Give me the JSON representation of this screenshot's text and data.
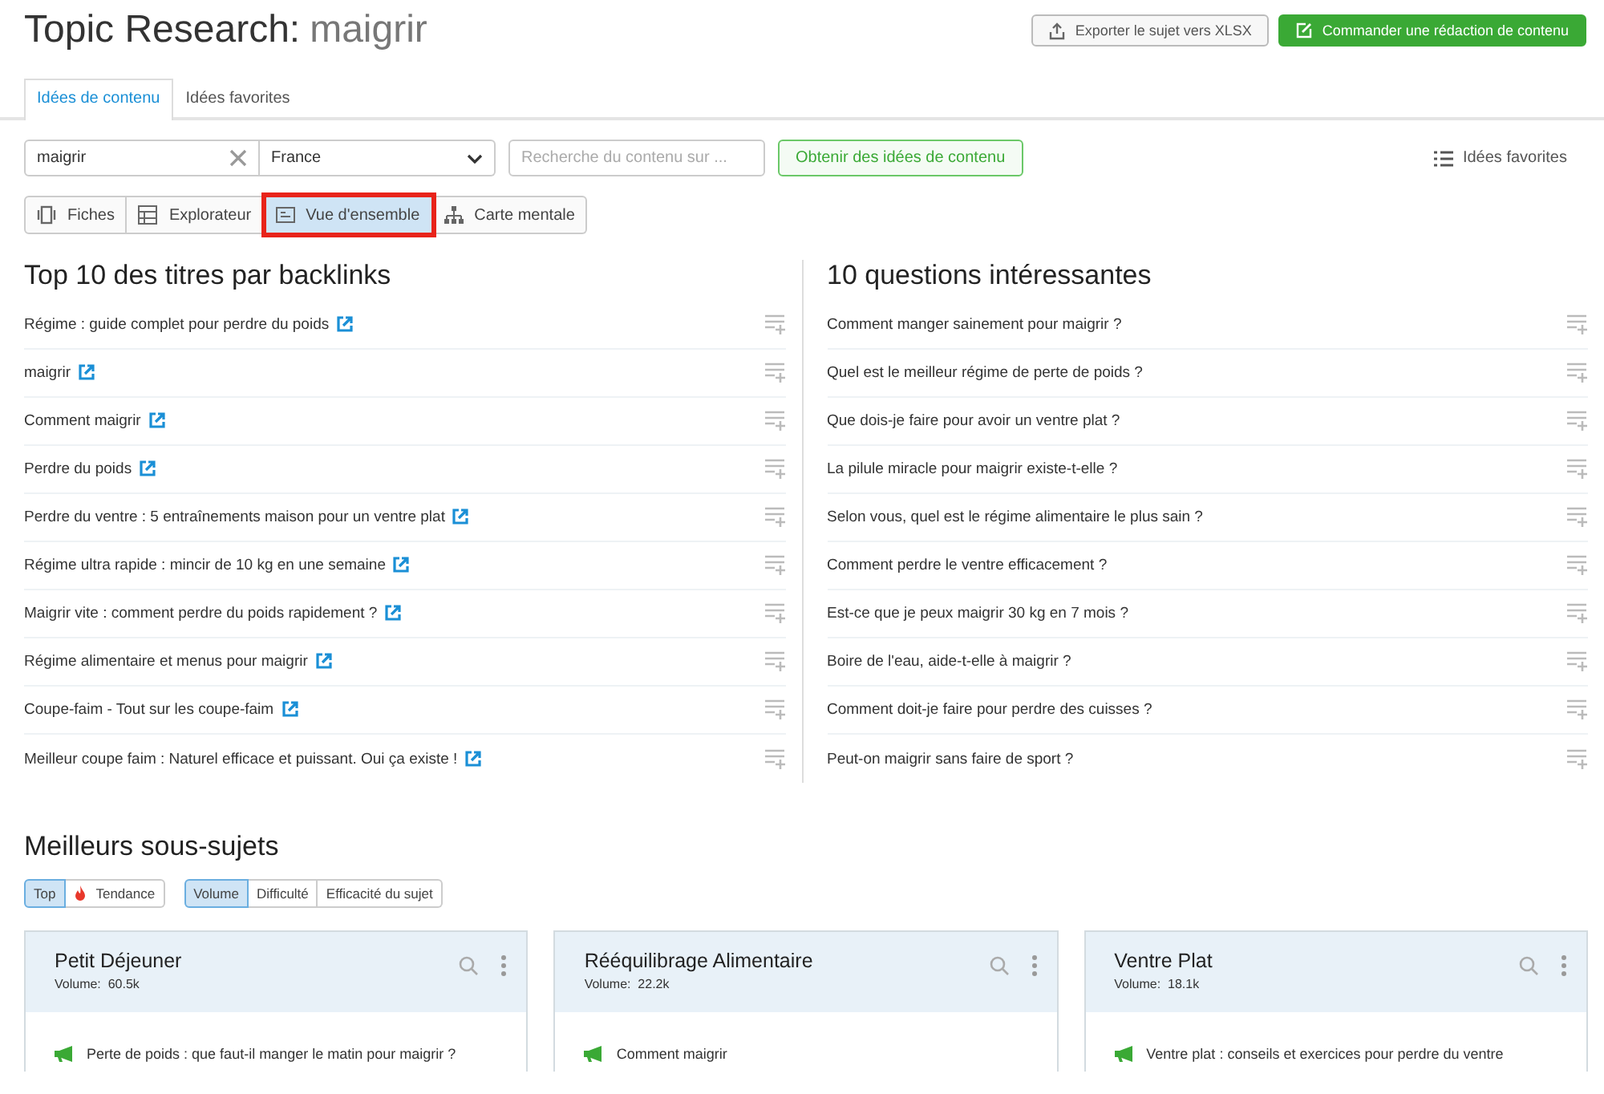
{
  "header": {
    "title": "Topic Research:",
    "keyword": "maigrir",
    "actions": [
      {
        "kind": "export",
        "label": "Exporter le sujet vers XLSX"
      },
      {
        "kind": "order",
        "label": "Commander une rédaction de contenu"
      }
    ]
  },
  "tabs": [
    {
      "label": "Idées de contenu",
      "selected": true
    },
    {
      "label": "Idées favorites",
      "selected": false
    }
  ],
  "search": {
    "keyword": "maigrir",
    "country": "France",
    "domain_placeholder": "Recherche du contenu sur ...",
    "submit": "Obtenir des idées de contenu",
    "favorites_link": "Idées favorites"
  },
  "views": [
    {
      "kind": "cards",
      "label": "Fiches",
      "selected": false,
      "highlighted": false
    },
    {
      "kind": "table",
      "label": "Explorateur",
      "selected": false,
      "highlighted": false
    },
    {
      "kind": "overview",
      "label": "Vue d'ensemble",
      "selected": true,
      "highlighted": true
    },
    {
      "kind": "mindmap",
      "label": "Carte mentale",
      "selected": false,
      "highlighted": false
    }
  ],
  "columns": [
    {
      "title": "Top 10 des titres par backlinks",
      "items": [
        {
          "text": "Régime : guide complet pour perdre du poids",
          "external": true
        },
        {
          "text": "maigrir",
          "external": true
        },
        {
          "text": "Comment maigrir",
          "external": true
        },
        {
          "text": "Perdre du poids",
          "external": true
        },
        {
          "text": "Perdre du ventre : 5 entraînements maison pour un ventre plat",
          "external": true
        },
        {
          "text": "Régime ultra rapide : mincir de 10 kg en une semaine",
          "external": true
        },
        {
          "text": "Maigrir vite : comment perdre du poids rapidement ?",
          "external": true
        },
        {
          "text": "Régime alimentaire et menus pour maigrir",
          "external": true
        },
        {
          "text": "Coupe-faim - Tout sur les coupe-faim",
          "external": true
        },
        {
          "text": "Meilleur coupe faim : Naturel efficace et puissant. Oui ça existe !",
          "external": true
        }
      ]
    },
    {
      "title": "10 questions intéressantes",
      "items": [
        {
          "text": "Comment manger sainement pour maigrir ?",
          "external": false
        },
        {
          "text": "Quel est le meilleur régime de perte de poids ?",
          "external": false
        },
        {
          "text": "Que dois-je faire pour avoir un ventre plat ?",
          "external": false
        },
        {
          "text": "La pilule miracle pour maigrir existe-t-elle ?",
          "external": false
        },
        {
          "text": "Selon vous, quel est le régime alimentaire le plus sain ?",
          "external": false
        },
        {
          "text": "Comment perdre le ventre efficacement ?",
          "external": false
        },
        {
          "text": "Est-ce que je peux maigrir 30 kg en 7 mois ?",
          "external": false
        },
        {
          "text": "Boire de l'eau, aide-t-elle à maigrir ?",
          "external": false
        },
        {
          "text": "Comment doit-je faire pour perdre des cuisses ?",
          "external": false
        },
        {
          "text": "Peut-on maigrir sans faire de sport ?",
          "external": false
        }
      ]
    }
  ],
  "subtopics": {
    "title": "Meilleurs sous-sujets",
    "mode_filters": [
      {
        "label": "Top",
        "selected": true,
        "trending": false
      },
      {
        "label": "Tendance",
        "selected": false,
        "trending": true
      }
    ],
    "sort_filters": [
      {
        "label": "Volume",
        "selected": true
      },
      {
        "label": "Difficulté",
        "selected": false
      },
      {
        "label": "Efficacité du sujet",
        "selected": false
      }
    ],
    "cards": [
      {
        "title": "Petit Déjeuner",
        "volume": "Volume:  60.5k",
        "headline": "Perte de poids : que faut-il manger le matin pour maigrir ?"
      },
      {
        "title": "Rééquilibrage Alimentaire",
        "volume": "Volume:  22.2k",
        "headline": "Comment maigrir"
      },
      {
        "title": "Ventre Plat",
        "volume": "Volume:  18.1k",
        "headline": "Ventre plat : conseils et exercices pour perdre du ventre"
      }
    ]
  }
}
